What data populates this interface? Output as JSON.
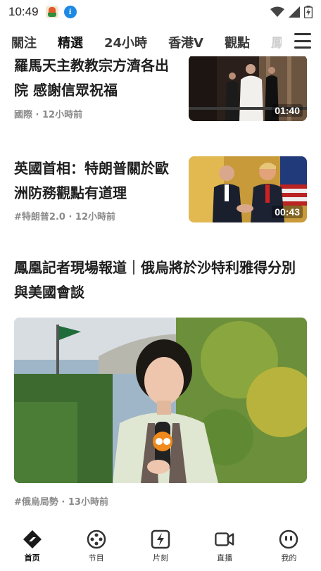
{
  "status_bar": {
    "time": "10:49",
    "left_icons": [
      "app-notification-icon",
      "download-icon"
    ],
    "download_glyph": "⭳",
    "right_icons": [
      "wifi-icon",
      "signal-icon",
      "battery-charging-icon"
    ]
  },
  "tabs": [
    {
      "label": "關注",
      "active": false
    },
    {
      "label": "精選",
      "active": true
    },
    {
      "label": "24小時",
      "active": false
    },
    {
      "label": "香港V",
      "active": false
    },
    {
      "label": "觀點",
      "active": false
    },
    {
      "label": "鳳",
      "active": false
    }
  ],
  "articles": [
    {
      "title": "羅馬天主教教宗方濟各出院 感謝信眾祝福",
      "meta": "國際 · 12小時前",
      "duration": "01:40"
    },
    {
      "title": "英國首相：特朗普關於歐洲防務觀點有道理",
      "meta": "#特朗普2.0 · 12小時前",
      "duration": "00:43"
    },
    {
      "title": "鳳凰記者現場報道｜俄烏將於沙特利雅得分別與美國會談",
      "meta": "#俄烏局勢 · 13小時前"
    }
  ],
  "bottom_nav": [
    {
      "label": "首页",
      "icon": "home-icon",
      "active": true
    },
    {
      "label": "节目",
      "icon": "film-reel-icon",
      "active": false
    },
    {
      "label": "片刻",
      "icon": "lightning-icon",
      "active": false
    },
    {
      "label": "直播",
      "icon": "video-camera-icon",
      "active": false
    },
    {
      "label": "我的",
      "icon": "profile-face-icon",
      "active": false
    }
  ],
  "colors": {
    "text_primary": "#1e1e1e",
    "text_meta": "#8a8a8a",
    "background": "#ffffff"
  }
}
